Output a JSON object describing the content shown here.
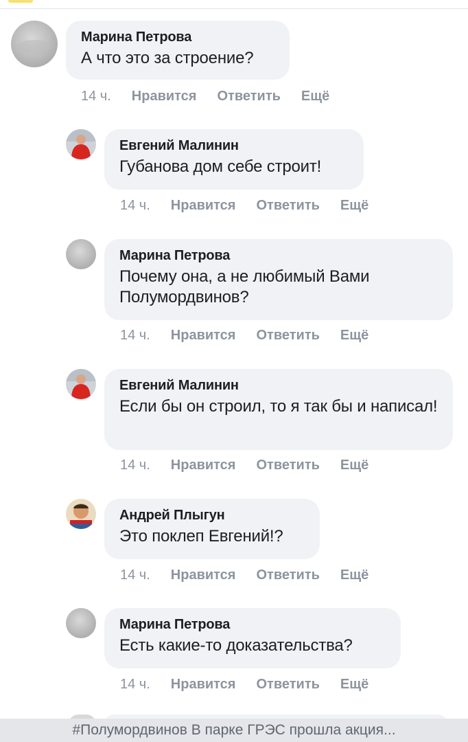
{
  "comments": [
    {
      "author": "Марина Петрова",
      "text": "А что это за строение?",
      "time": "14 ч.",
      "like": "Нравится",
      "reply": "Ответить",
      "more": "Ещё"
    },
    {
      "author": "Евгений Малинин",
      "text": "Губанова дом себе строит!",
      "time": "14 ч.",
      "like": "Нравится",
      "reply": "Ответить",
      "more": "Ещё"
    },
    {
      "author": "Марина Петрова",
      "text": "Почему она, а не любимый Вами Полумордвинов?",
      "time": "14 ч.",
      "like": "Нравится",
      "reply": "Ответить",
      "more": "Ещё"
    },
    {
      "author": "Евгений Малинин",
      "text": "Если бы он строил, то я так бы и написал!",
      "time": "14 ч.",
      "like": "Нравится",
      "reply": "Ответить",
      "more": "Ещё"
    },
    {
      "author": "Андрей Плыгун",
      "text": "Это поклеп Евгений!?",
      "time": "14 ч.",
      "like": "Нравится",
      "reply": "Ответить",
      "more": "Ещё"
    },
    {
      "author": "Марина Петрова",
      "text": "Есть какие-то доказательства?",
      "time": "14 ч.",
      "like": "Нравится",
      "reply": "Ответить",
      "more": "Ещё"
    }
  ],
  "bottom_bar": {
    "text": "#Полумордвинов В парке ГРЭС прошла акция..."
  },
  "colors": {
    "bubble": "#f0f2f5",
    "meta": "#8d949e",
    "text": "#1c1e21"
  },
  "icons": {
    "avatar_marina": "gray-avatar",
    "avatar_evgeny": "man-red-shirt-avatar",
    "avatar_andrey": "caricature-avatar"
  }
}
